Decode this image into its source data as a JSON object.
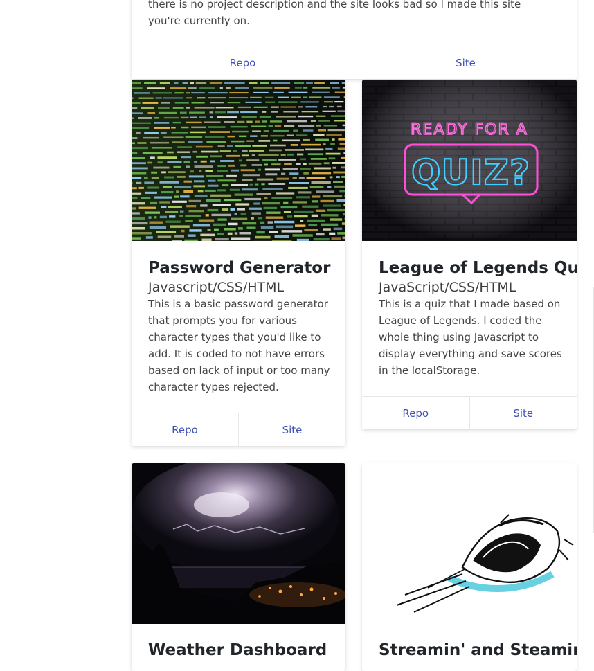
{
  "cards": [
    {
      "text": "there is no project description and the site looks bad so I made this site you're currently on.",
      "repo_label": "Repo",
      "site_label": "Site"
    },
    {
      "image_alt": "code-screenshot-image",
      "title": "Password Generator",
      "subtitle": "Javascript/CSS/HTML",
      "text": "This is a basic password generator that prompts you for various character types that you'd like to add. It is coded to not have errors based on lack of input or too many character types rejected.",
      "repo_label": "Repo",
      "site_label": "Site"
    },
    {
      "image_text_1": "READY FOR A",
      "image_text_2": "QUIZ?",
      "title": "League of Legends Quiz",
      "subtitle": "JavaScript/CSS/HTML",
      "text": "This is a quiz that I made based on League of Legends. I coded the whole thing using Javascript to display everything and save scores in the localStorage.",
      "repo_label": "Repo",
      "site_label": "Site"
    },
    {
      "title": "Weather Dashboard"
    },
    {
      "title": "Streamin' and Steamin'"
    }
  ],
  "colors": {
    "link": "#3f51b5",
    "title": "#212529",
    "neon_pink": "#ff4fd8",
    "neon_blue": "#3fd0ff"
  }
}
